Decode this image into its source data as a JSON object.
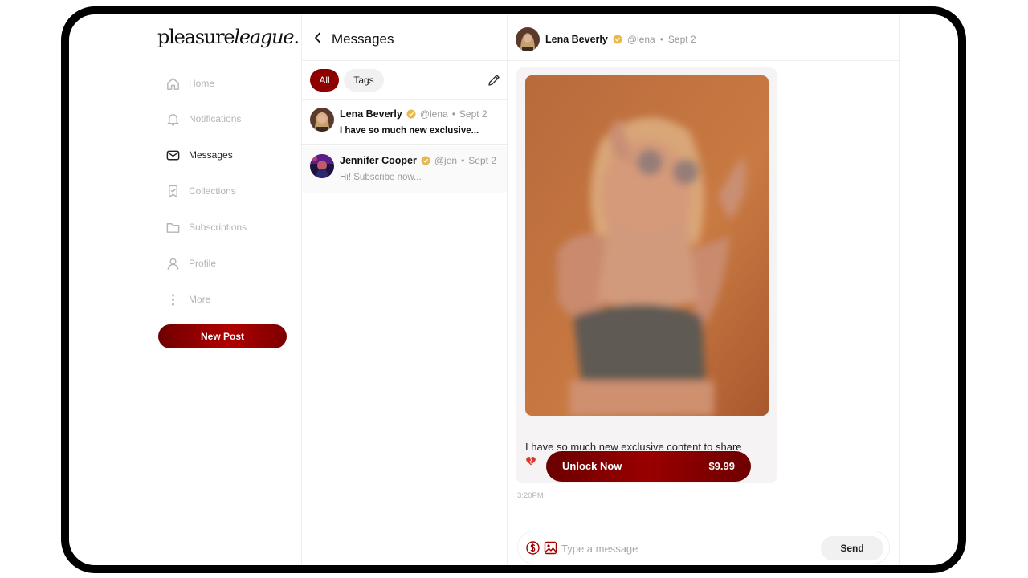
{
  "brand": {
    "logo_regular": "pleasure",
    "logo_italic": "league.",
    "accent": "#8e0000",
    "verified_color": "#e8b84a"
  },
  "sidebar": {
    "items": [
      {
        "label": "Home",
        "icon": "home-icon",
        "active": false
      },
      {
        "label": "Notifications",
        "icon": "bell-icon",
        "active": false
      },
      {
        "label": "Messages",
        "icon": "mail-icon",
        "active": true
      },
      {
        "label": "Collections",
        "icon": "bookmark-icon",
        "active": false
      },
      {
        "label": "Subscriptions",
        "icon": "folder-icon",
        "active": false
      },
      {
        "label": "Profile",
        "icon": "user-icon",
        "active": false
      },
      {
        "label": "More",
        "icon": "more-vertical-icon",
        "active": false
      }
    ],
    "new_post_label": "New Post"
  },
  "messages_panel": {
    "title": "Messages",
    "filters": [
      {
        "label": "All",
        "selected": true
      },
      {
        "label": "Tags",
        "selected": false
      }
    ],
    "conversations": [
      {
        "name": "Lena Beverly",
        "handle": "@lena",
        "date": "Sept 2",
        "preview": "I have so much new exclusive...",
        "unread": true,
        "selected": true
      },
      {
        "name": "Jennifer Cooper",
        "handle": "@jen",
        "date": "Sept 2",
        "preview": "Hi! Subscribe now...",
        "unread": false,
        "selected": false
      }
    ]
  },
  "chat": {
    "header": {
      "name": "Lena Beverly",
      "handle": "@lena",
      "date": "Sept 2"
    },
    "message": {
      "unlock_label": "Unlock Now",
      "price": "$9.99",
      "text": "I have so much new exclusive content to share",
      "time": "3:20PM"
    },
    "composer": {
      "placeholder": "Type a message",
      "send_label": "Send"
    }
  }
}
